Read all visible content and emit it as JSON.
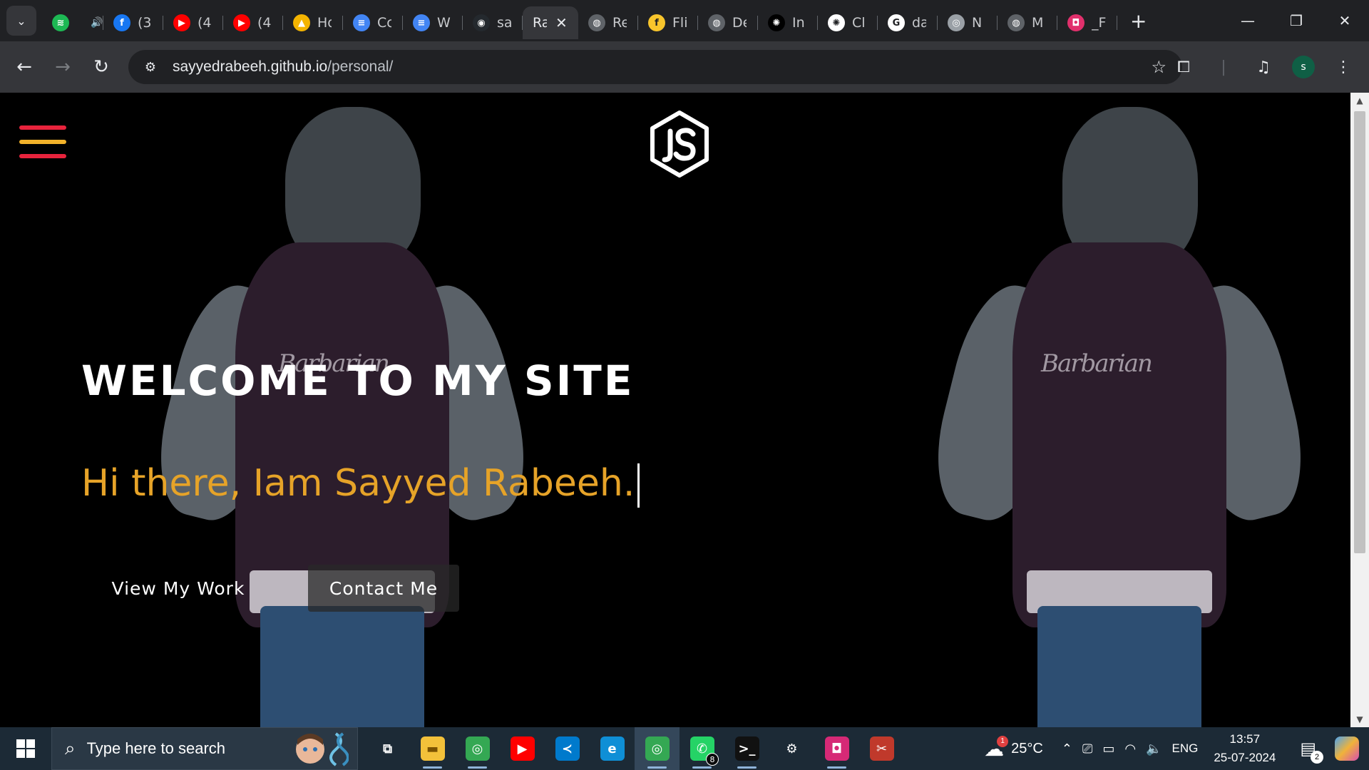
{
  "browser": {
    "tabs": [
      {
        "label": "",
        "icon": "spotify-icon",
        "color": "#1db954",
        "glyph": "≋",
        "audio": "🔊"
      },
      {
        "label": "(3",
        "icon": "facebook-icon",
        "color": "#1877f2",
        "glyph": "f"
      },
      {
        "label": "(4",
        "icon": "youtube-icon",
        "color": "#ff0000",
        "glyph": "▶"
      },
      {
        "label": "(4",
        "icon": "youtube-icon",
        "color": "#ff0000",
        "glyph": "▶"
      },
      {
        "label": "Ho",
        "icon": "google-drive-icon",
        "color": "#f4b400",
        "glyph": "▲"
      },
      {
        "label": "Cc",
        "icon": "google-docs-icon",
        "color": "#4285f4",
        "glyph": "≡"
      },
      {
        "label": "W",
        "icon": "google-docs-icon",
        "color": "#4285f4",
        "glyph": "≡"
      },
      {
        "label": "sa",
        "icon": "github-icon",
        "color": "#24292e",
        "glyph": "◉"
      },
      {
        "label": "Ra",
        "icon": "page-icon",
        "color": "#35363a",
        "glyph": "",
        "active": true
      },
      {
        "label": "Re",
        "icon": "globe-icon",
        "color": "#5f6368",
        "glyph": "◍"
      },
      {
        "label": "Fli",
        "icon": "flipkart-icon",
        "color": "#f8c52c",
        "glyph": "f"
      },
      {
        "label": "De",
        "icon": "globe-icon",
        "color": "#5f6368",
        "glyph": "◍"
      },
      {
        "label": "In",
        "icon": "openai-icon",
        "color": "#000000",
        "glyph": "✺"
      },
      {
        "label": "Cl",
        "icon": "openai-icon",
        "color": "#ffffff",
        "glyph": "✺"
      },
      {
        "label": "da",
        "icon": "google-icon",
        "color": "#ffffff",
        "glyph": "G"
      },
      {
        "label": "N",
        "icon": "chrome-icon",
        "color": "#9aa0a6",
        "glyph": "◎"
      },
      {
        "label": "M",
        "icon": "globe-icon",
        "color": "#5f6368",
        "glyph": "◍"
      },
      {
        "label": "_F",
        "icon": "instagram-icon",
        "color": "#e1306c",
        "glyph": "◘"
      }
    ],
    "url_host": "sayyedrabeeh.github.io",
    "url_path": "/personal/",
    "profile_initial": "s"
  },
  "page": {
    "welcome": "WELCOME TO MY SITE",
    "intro": "Hi there, Iam Sayyed Rabeeh.",
    "view_work": "View My Work",
    "contact": "Contact Me",
    "hoodie_print": "Barbarian",
    "menu_colors": [
      "#e8233c",
      "#f2b22a",
      "#e8233c"
    ]
  },
  "taskbar": {
    "search_placeholder": "Type here to search",
    "apps": [
      {
        "name": "task-view-icon",
        "glyph": "⧉",
        "color": "transparent"
      },
      {
        "name": "file-explorer-icon",
        "glyph": "▬",
        "color": "#f3c13a",
        "running": true
      },
      {
        "name": "chrome-icon",
        "glyph": "◎",
        "color": "#34a853",
        "running": true
      },
      {
        "name": "youtube-icon",
        "glyph": "▶",
        "color": "#ff0000"
      },
      {
        "name": "vscode-icon",
        "glyph": "≺",
        "color": "#007acc"
      },
      {
        "name": "edge-icon",
        "glyph": "e",
        "color": "#0f8fd6"
      },
      {
        "name": "chrome-profile-icon",
        "glyph": "◎",
        "color": "#34a853",
        "running": true,
        "active": true
      },
      {
        "name": "whatsapp-icon",
        "glyph": "✆",
        "color": "#25d366",
        "running": true,
        "badge": "8"
      },
      {
        "name": "terminal-icon",
        "glyph": ">_",
        "color": "#111111",
        "running": true
      },
      {
        "name": "settings-icon",
        "glyph": "⚙",
        "color": "transparent"
      },
      {
        "name": "instagram-icon",
        "glyph": "◘",
        "color": "#d62976",
        "running": true
      },
      {
        "name": "snipping-tool-icon",
        "glyph": "✂",
        "color": "#c0392b"
      }
    ],
    "weather": "25°C",
    "weather_badge": "1",
    "language": "ENG",
    "time": "13:57",
    "date": "25-07-2024",
    "notifications": "2"
  }
}
